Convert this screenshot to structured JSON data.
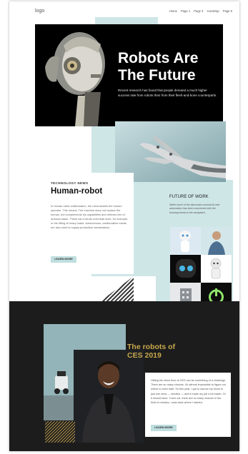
{
  "header": {
    "logo": "logo",
    "nav": [
      "Home",
      "Page 1",
      "Page 3",
      "Iconstrap",
      "Page 5"
    ]
  },
  "hero": {
    "title_line1": "Robots Are",
    "title_line2": "The Future",
    "subtitle": "Recent research has found that people demand a much higher success rate from robots than from their flesh-and-bone counterparts."
  },
  "news": {
    "kicker": "TECHNOLOGY NEWS",
    "title": "Human-robot",
    "body": "In human-robot collaboration, the robot assists the human operator. This means: The machine does not replace the human, but complements his capabilities and relieves him of arduous tasks. These can include overhead work, for example, or the lifting of heavy loads. Autonomous, collaborative robots are also used to supply production workstations.",
    "button": "LEARN MORE"
  },
  "future": {
    "title": "FUTURE OF WORK",
    "description": "While much of the discussion around AI and automation has been concerned with the looming threat to the workplace,"
  },
  "ces": {
    "title_line1": "The robots of",
    "title_line2": "CES 2019",
    "body": "Hitting the show floor at CES can be something of a challenge. There are so many choices, it's almost impossible to figure out where to even start. So this year, I got to narrow my focus to just one area — robotics — and it made my job a lot easier. Or it should have. Turns out, there are so many choices in the field of robotics, I was back where I started.",
    "button": "LEARN MORE"
  },
  "colors": {
    "teal": "#cfe6e7",
    "dark": "#1c1c1c",
    "gold": "#c7a84e",
    "button": "#bfdedf"
  }
}
